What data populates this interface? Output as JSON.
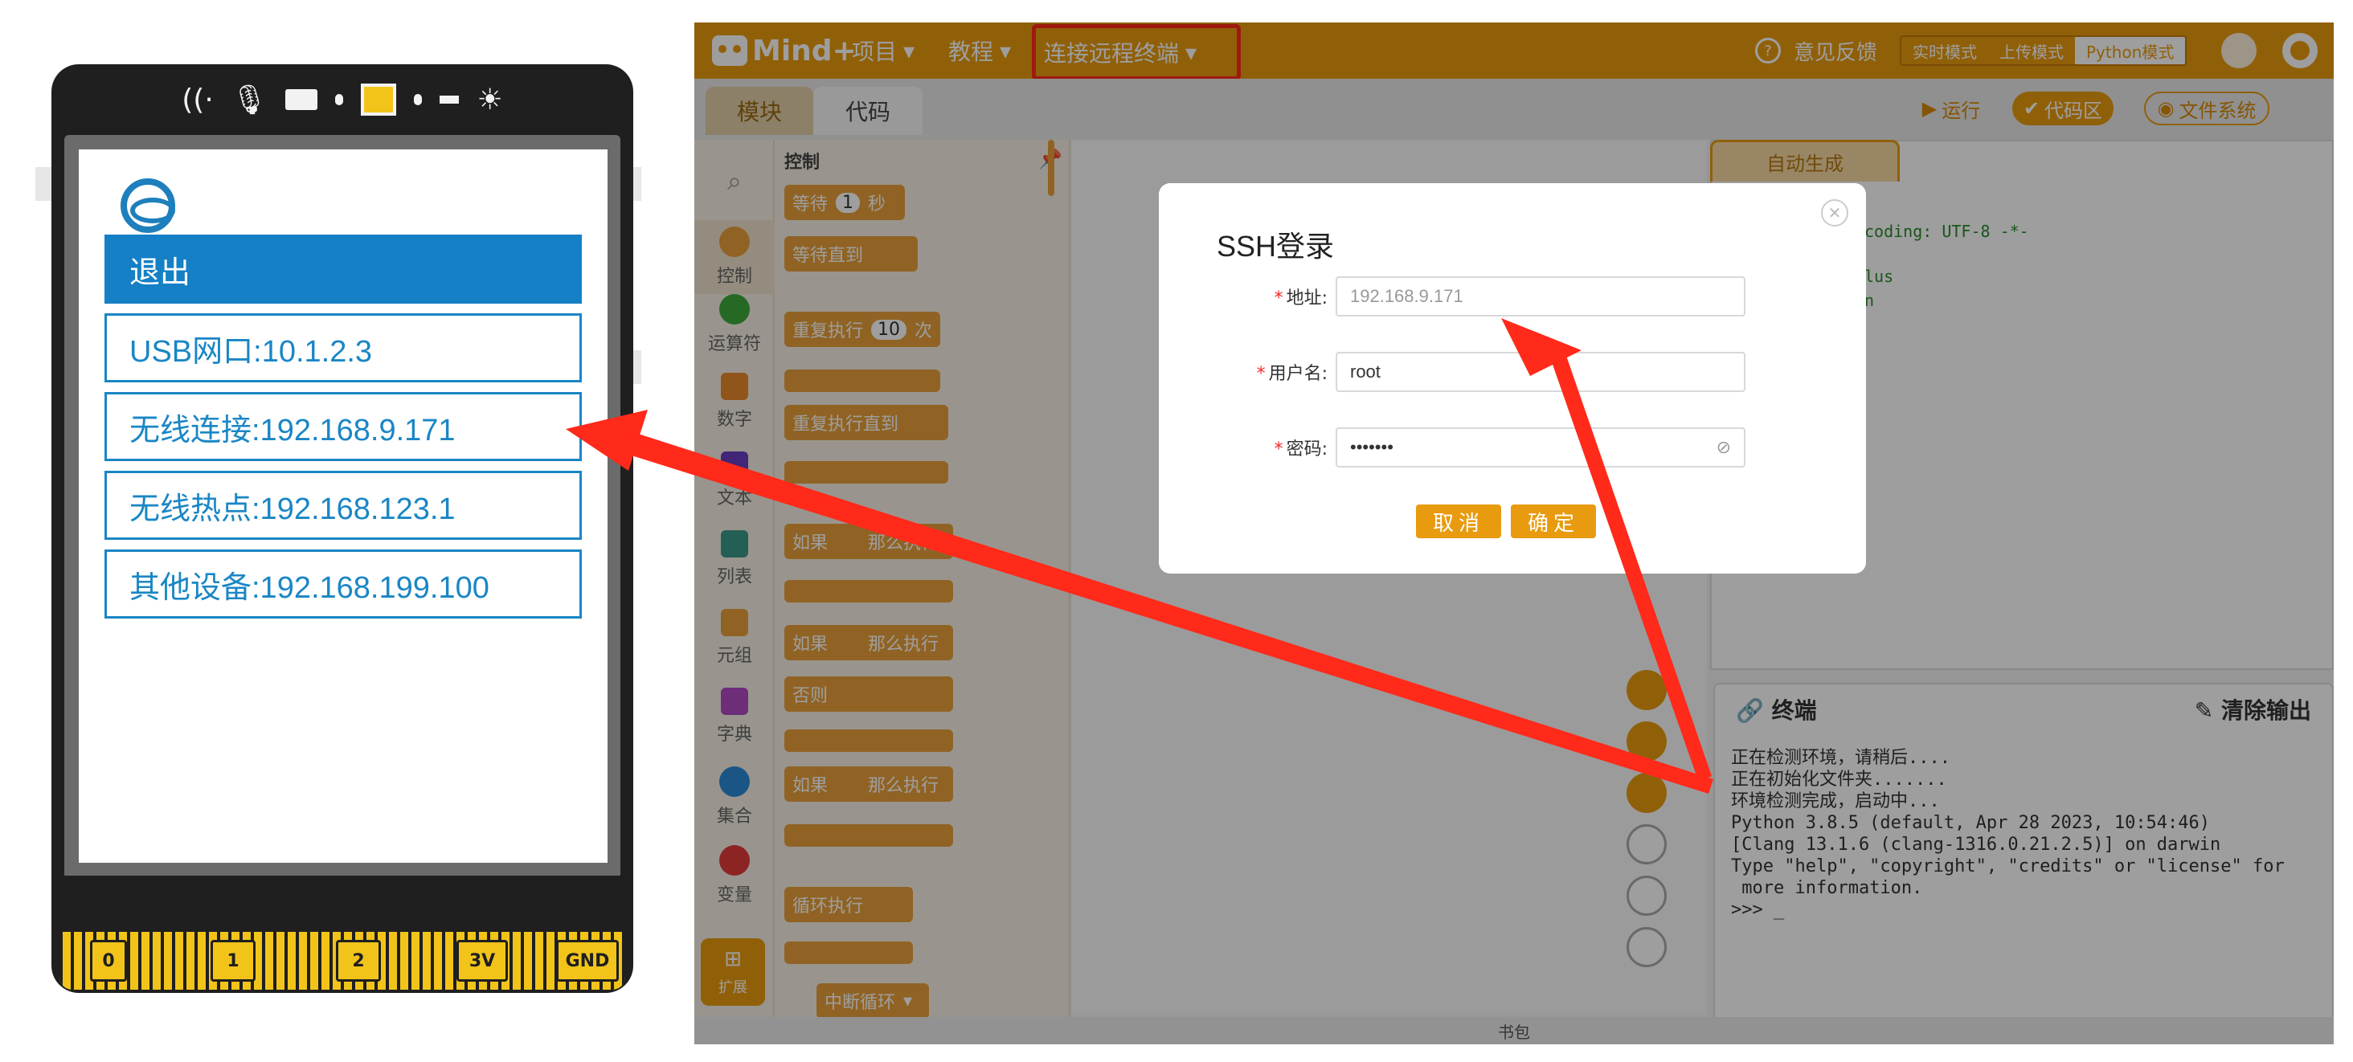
{
  "device": {
    "menu": [
      {
        "label": "退出"
      },
      {
        "label": "USB网口:10.1.2.3"
      },
      {
        "label": "无线连接:192.168.9.171"
      },
      {
        "label": "无线热点:192.168.123.1"
      },
      {
        "label": "其他设备:192.168.199.100"
      }
    ],
    "pins": [
      "0",
      "1",
      "2",
      "3V",
      "GND"
    ]
  },
  "app": {
    "brand": "Mind+",
    "menus": [
      "项目",
      "教程",
      "连接远程终端"
    ],
    "feedback": "意见反馈",
    "modes": [
      "实时模式",
      "上传模式",
      "Python模式"
    ],
    "tabs": {
      "blocks": "模块",
      "code": "代码"
    },
    "actions": {
      "run": "运行",
      "code_area": "代码区",
      "filesystem": "文件系统"
    },
    "categories": [
      "控制",
      "运算符",
      "数字",
      "文本",
      "列表",
      "元组",
      "字典",
      "集合",
      "变量"
    ],
    "extension": "扩展",
    "palette_header": "控制",
    "blocks": [
      {
        "text": "等待",
        "value": "1",
        "suffix": "秒"
      },
      {
        "text": "等待直到"
      },
      {
        "text": "重复执行",
        "value": "10",
        "suffix": "次"
      },
      {
        "text": "重复执行直到"
      },
      {
        "text": "如果",
        "suffix": "那么执行"
      },
      {
        "text": "如果",
        "suffix": "那么执行"
      },
      {
        "text": "否则"
      },
      {
        "text": "如果",
        "suffix": "那么执行"
      },
      {
        "text": "循环执行"
      },
      {
        "text": "中断循环"
      }
    ],
    "auto_tab": "自动生成",
    "code_lines": [
      "coding: UTF-8 -*-",
      "lus",
      "n"
    ],
    "terminal": {
      "title": "终端",
      "clear": "清除输出",
      "text": "正在检测环境，请稍后....\n正在初始化文件夹.......\n环境检测完成，启动中...\nPython 3.8.5 (default, Apr 28 2023, 10:54:46)\n[Clang 13.1.6 (clang-1316.0.21.2.5)] on darwin\nType \"help\", \"copyright\", \"credits\" or \"license\" for\n more information.\n>>> _"
    },
    "statusbar": "书包",
    "dialog": {
      "title": "SSH登录",
      "address_label": "地址:",
      "address_value": "192.168.9.171",
      "user_label": "用户名:",
      "user_value": "root",
      "password_label": "密码:",
      "password_value": "•••••••",
      "cancel": "取消",
      "confirm": "确定"
    }
  },
  "colors": {
    "accent": "#e89b0f",
    "device_blue": "#1580c6",
    "arrow": "#ff2a1a"
  }
}
